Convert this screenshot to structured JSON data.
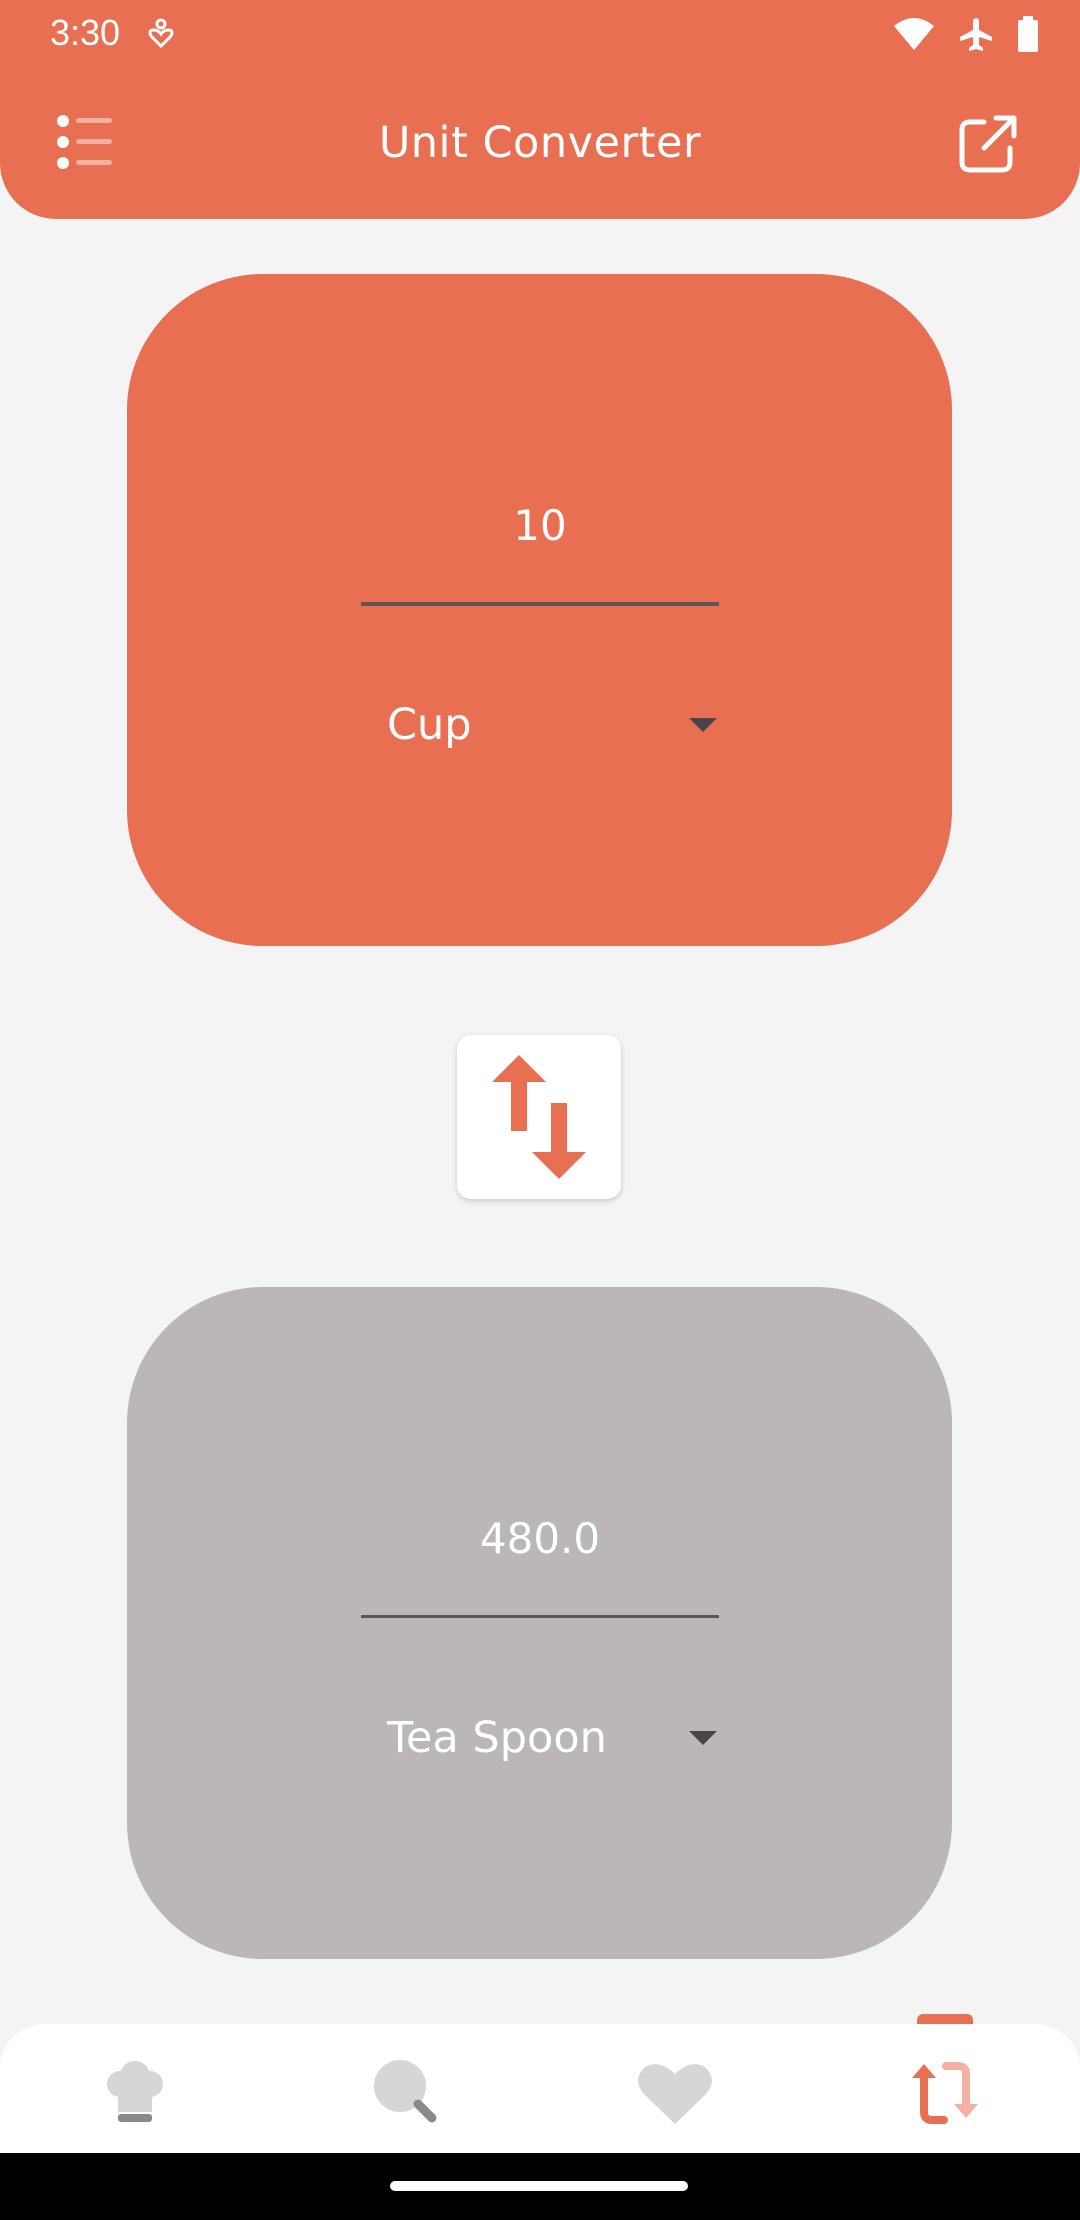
{
  "status_bar": {
    "time": "3:30"
  },
  "app_bar": {
    "title": "Unit Converter"
  },
  "from": {
    "value": "10",
    "unit": "Cup"
  },
  "to": {
    "value": "480.0",
    "unit": "Tea Spoon"
  },
  "colors": {
    "accent": "#e86f52",
    "result_card": "#bbb7b7",
    "background": "#f4f4f4",
    "nav_inactive": "#d6d6d6"
  },
  "icons": {
    "menu": "menu-list-icon",
    "share": "open-external-icon",
    "swap": "swap-vertical-icon",
    "nav": [
      "chef-hat-icon",
      "search-icon",
      "heart-icon",
      "convert-icon"
    ]
  }
}
